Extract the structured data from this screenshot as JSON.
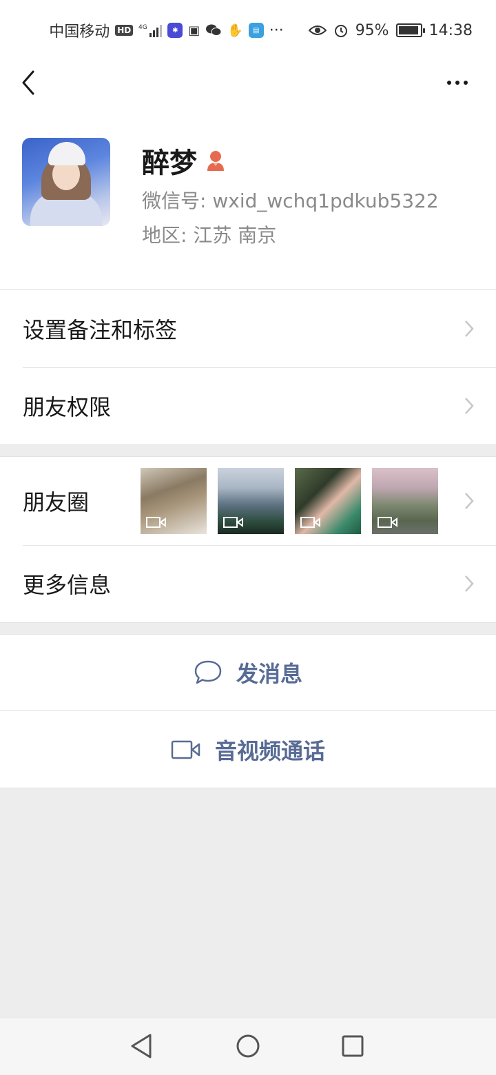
{
  "status_bar": {
    "carrier": "中国移动",
    "hd": "HD",
    "network": "4G",
    "dots": "···",
    "battery_pct": "95%",
    "time": "14:38",
    "battery_level": 0.95
  },
  "profile": {
    "name": "醉梦",
    "wxid_label": "微信号:",
    "wxid": "wxid_wchq1pdkub5322",
    "region_label": "地区:",
    "region": "江苏  南京",
    "gender_icon": "female-icon",
    "gender_color": "#e66a4f"
  },
  "menu": {
    "remarks_label": "设置备注和标签",
    "permissions_label": "朋友权限",
    "moments_label": "朋友圈",
    "more_info_label": "更多信息"
  },
  "actions": {
    "message_label": "发消息",
    "call_label": "音视频通话"
  },
  "colors": {
    "link": "#576b95",
    "background": "#ededed"
  }
}
